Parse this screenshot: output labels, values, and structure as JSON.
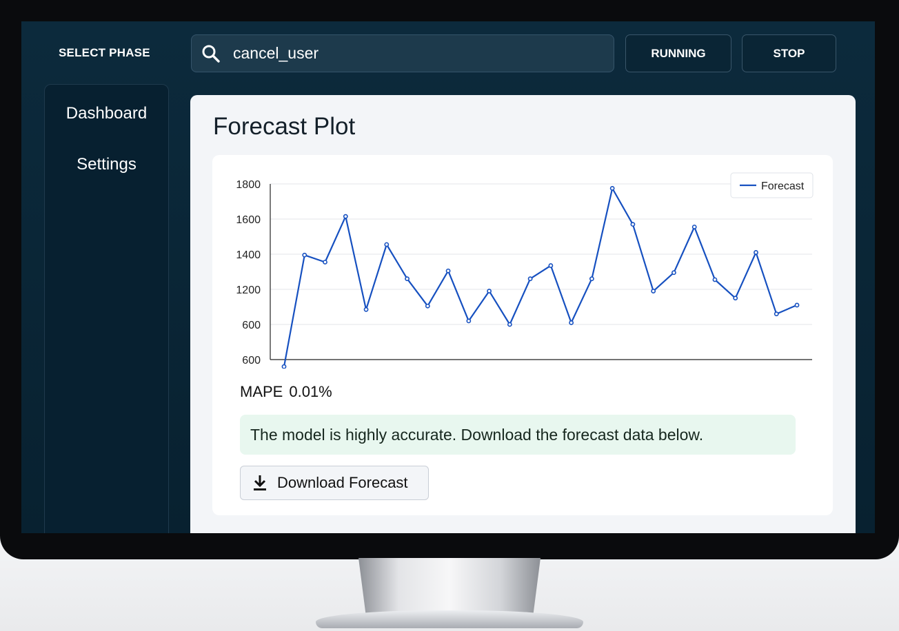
{
  "header": {
    "phase_label": "SELECT PHASE",
    "search_value": "cancel_user",
    "running_label": "RUNNING",
    "stop_label": "STOP"
  },
  "sidebar": {
    "items": [
      {
        "label": "Dashboard"
      },
      {
        "label": "Settings"
      }
    ]
  },
  "main": {
    "title": "Forecast Plot",
    "mape_label": "MAPE",
    "mape_value": "0.01%",
    "info_message": "The model is highly accurate. Download the forecast data below.",
    "download_label": "Download Forecast"
  },
  "icons": {
    "search": "search-icon",
    "download": "download-icon"
  },
  "colors": {
    "screen_bg": "#0c2a3c",
    "series": "#1650c0",
    "success_bg": "#e8f7ef"
  },
  "chart_data": {
    "type": "line",
    "ytick_labels": [
      "600",
      "600",
      "1200",
      "1400",
      "1600",
      "1800"
    ],
    "ylim": [
      800,
      1800
    ],
    "grid": true,
    "legend_position": "top-right",
    "series": [
      {
        "name": "Forecast",
        "color": "#1650c0",
        "values": [
          760,
          1395,
          1355,
          1615,
          1085,
          1455,
          1260,
          1105,
          1305,
          1020,
          1190,
          1000,
          1260,
          1335,
          1010,
          1260,
          1775,
          1570,
          1190,
          1295,
          1555,
          1255,
          1150,
          1410,
          1060,
          1110
        ]
      }
    ]
  }
}
